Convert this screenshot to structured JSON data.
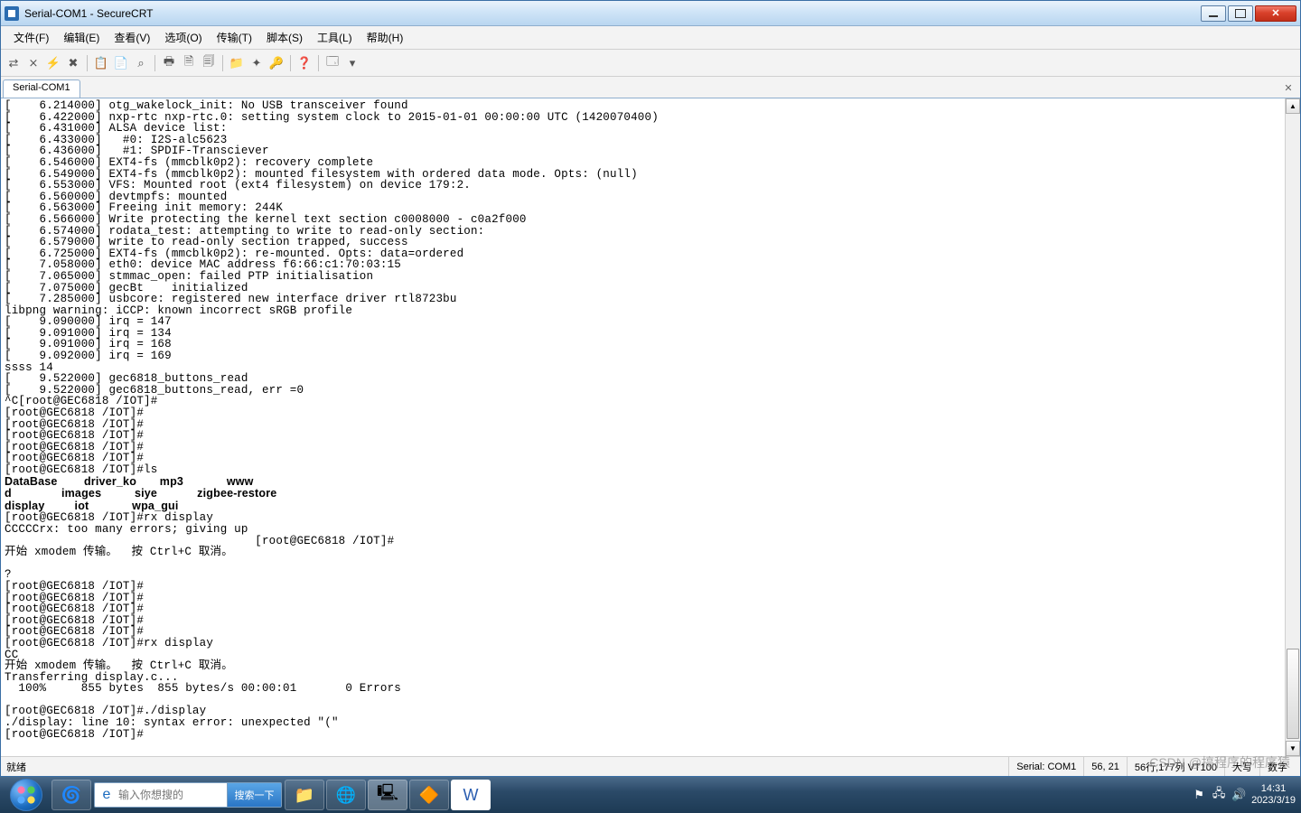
{
  "title": "Serial-COM1 - SecureCRT",
  "menu": [
    "文件(F)",
    "编辑(E)",
    "查看(V)",
    "选项(O)",
    "传输(T)",
    "脚本(S)",
    "工具(L)",
    "帮助(H)"
  ],
  "toolbar_icons": [
    "reconnect-icon",
    "disconnect-icon",
    "quick-connect-icon",
    "options-icon",
    "",
    "copy-icon",
    "paste-icon",
    "find-icon",
    "",
    "print-icon",
    "print-setup-icon",
    "print-preview-icon",
    "",
    "log-icon",
    "clear-icon",
    "lock-icon",
    "",
    "help-icon",
    "",
    "session-icon",
    "dropdown-icon"
  ],
  "toolbar_glyphs": [
    "⇄",
    "⨯",
    "⚡",
    "✖",
    "|",
    "📋",
    "📄",
    "⌕",
    "|",
    "🖶",
    "🗎",
    "🗐",
    "|",
    "📁",
    "✦",
    "🔑",
    "|",
    "❓",
    "|",
    "🗔",
    "▾"
  ],
  "tab": "Serial-COM1",
  "tab_close": "✕",
  "terminal_lines": [
    "[    6.214000] otg_wakelock_init: No USB transceiver found",
    "[    6.422000] nxp-rtc nxp-rtc.0: setting system clock to 2015-01-01 00:00:00 UTC (1420070400)",
    "[    6.431000] ALSA device list:",
    "[    6.433000]   #0: I2S-alc5623",
    "[    6.436000]   #1: SPDIF-Transciever",
    "[    6.546000] EXT4-fs (mmcblk0p2): recovery complete",
    "[    6.549000] EXT4-fs (mmcblk0p2): mounted filesystem with ordered data mode. Opts: (null)",
    "[    6.553000] VFS: Mounted root (ext4 filesystem) on device 179:2.",
    "[    6.560000] devtmpfs: mounted",
    "[    6.563000] Freeing init memory: 244K",
    "[    6.566000] Write protecting the kernel text section c0008000 - c0a2f000",
    "[    6.574000] rodata_test: attempting to write to read-only section:",
    "[    6.579000] write to read-only section trapped, success",
    "[    6.725000] EXT4-fs (mmcblk0p2): re-mounted. Opts: data=ordered",
    "[    7.058000] eth0: device MAC address f6:66:c1:70:03:15",
    "[    7.065000] stmmac_open: failed PTP initialisation",
    "[    7.075000] gecBt    initialized",
    "[    7.285000] usbcore: registered new interface driver rtl8723bu",
    "libpng warning: iCCP: known incorrect sRGB profile",
    "[    9.090000] irq = 147",
    "[    9.091000] irq = 134",
    "[    9.091000] irq = 168",
    "[    9.092000] irq = 169",
    "ssss 14",
    "[    9.522000] gec6818_buttons_read",
    "[    9.522000] gec6818_buttons_read, err =0",
    "^C[root@GEC6818 /IOT]#",
    "[root@GEC6818 /IOT]#",
    "[root@GEC6818 /IOT]#",
    "[root@GEC6818 /IOT]#",
    "[root@GEC6818 /IOT]#",
    "[root@GEC6818 /IOT]#",
    "[root@GEC6818 /IOT]#ls"
  ],
  "ls_row1": {
    "c0": "DataBase",
    "c1": "driver_ko",
    "c2": "mp3",
    "c3": "www"
  },
  "ls_row2": {
    "c0": "d",
    "c1": "images",
    "c2": "siye",
    "c3": "zigbee-restore"
  },
  "ls_row3": {
    "c0": "display",
    "c1": "iot",
    "c2": "wpa_gui",
    "c3": ""
  },
  "terminal_lines2": [
    "[root@GEC6818 /IOT]#rx display",
    "CCCCCrx: too many errors; giving up",
    "                                    [root@GEC6818 /IOT]#",
    "开始 xmodem 传输。  按 Ctrl+C 取消。",
    "",
    "?",
    "[root@GEC6818 /IOT]#",
    "[root@GEC6818 /IOT]#",
    "[root@GEC6818 /IOT]#",
    "[root@GEC6818 /IOT]#",
    "[root@GEC6818 /IOT]#",
    "[root@GEC6818 /IOT]#rx display",
    "CC",
    "开始 xmodem 传输。  按 Ctrl+C 取消。",
    "Transferring display.c...",
    "  100%     855 bytes  855 bytes/s 00:00:01       0 Errors",
    "",
    "[root@GEC6818 /IOT]#./display",
    "./display: line 10: syntax error: unexpected \"(\"",
    "[root@GEC6818 /IOT]#"
  ],
  "status": {
    "left": "就绪",
    "conn": "Serial: COM1",
    "pos": "56, 21",
    "size": "56行,177列  VT100",
    "caps": "大写",
    "num": "数字"
  },
  "search_placeholder": "输入你想搜的",
  "search_go": "搜索一下",
  "tray_time": "14:31",
  "tray_date": "2023/3/19",
  "watermark": "CSDN @搞程序的程序猿"
}
